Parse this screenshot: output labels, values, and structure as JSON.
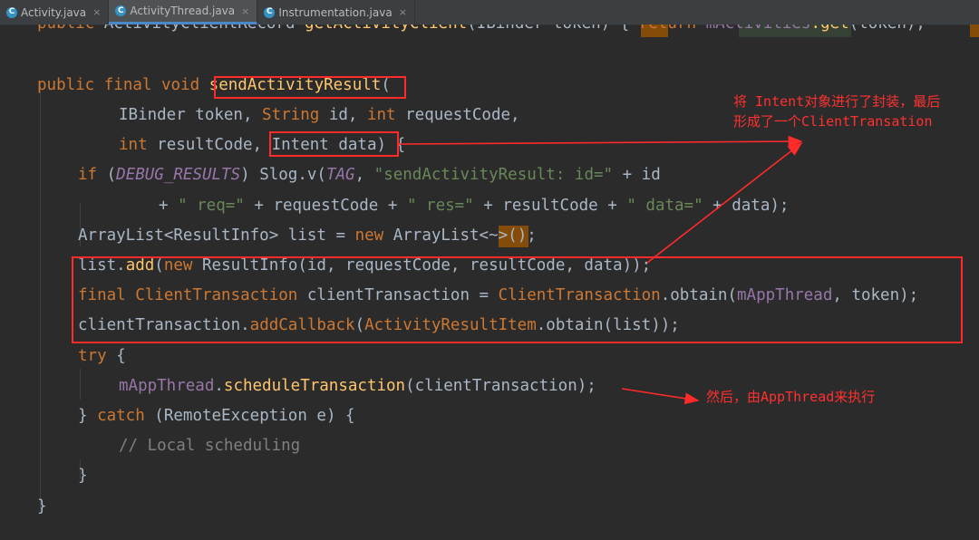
{
  "tabs": [
    {
      "icon": "C",
      "label": "Activity.java",
      "close": "×"
    },
    {
      "icon": "C",
      "label": "ActivityThread.java",
      "close": "×"
    },
    {
      "icon": "C",
      "label": "Instrumentation.java",
      "close": "×"
    }
  ],
  "code": {
    "l0": {
      "t1": "public ",
      "t2": "ActivityClientRecord ",
      "t3": "getActivityClient",
      "t4": "(IBinder token) ",
      "t5": "{",
      "t6": " return ",
      "t7": "mActivities",
      "t8": ".get",
      "t9": "(token);"
    },
    "l1": {
      "t1": "public ",
      "t2": "final ",
      "t3": "void ",
      "t4": "sendActivityResult",
      "t5": "("
    },
    "l2": {
      "t1": "IBinder token, ",
      "t2": "String ",
      "t3": "id, ",
      "t4": "int ",
      "t5": "requestCode,"
    },
    "l3": {
      "t1": "int ",
      "t2": "resultCode, ",
      "t3": "Intent ",
      "t4": "data",
      "t5": ")",
      "t6": " {"
    },
    "l4": {
      "t1": "if ",
      "t2": "(",
      "t3": "DEBUG_RESULTS",
      "t4": ") ",
      "t5": "Slog",
      "t6": ".v(",
      "t7": "TAG",
      "t8": ", ",
      "t9": "\"sendActivityResult: id=\"",
      "t10": " + id"
    },
    "l5": {
      "t1": "+ ",
      "t2": "\" req=\"",
      "t3": " + requestCode + ",
      "t4": "\" res=\"",
      "t5": " + resultCode + ",
      "t6": "\" data=\"",
      "t7": " + data);"
    },
    "l6": {
      "t1": "ArrayList",
      "t2": "<ResultInfo> ",
      "t3": "list = ",
      "t4": "new ",
      "t5": "ArrayList",
      "t6": "<~>",
      "t7": "();"
    },
    "l7": {
      "t1": "list.",
      "t2": "add",
      "t3": "(",
      "t4": "new ",
      "t5": "ResultInfo",
      "t6": "(id, requestCode, resultCode, data));"
    },
    "l8": {
      "t1": "final ",
      "t2": "ClientTransaction ",
      "t3": "clientTransaction = ",
      "t4": "ClientTransaction",
      "t5": ".obtain(",
      "t6": "mAppThread",
      "t7": ", token);"
    },
    "l9": {
      "t1": "clientTransaction.",
      "t2": "addCallback",
      "t3": "(",
      "t4": "ActivityResultItem",
      "t5": ".obtain(list));"
    },
    "l10": {
      "t1": "try ",
      "t2": "{"
    },
    "l11": {
      "t1": "mAppThread",
      "t2": ".",
      "t3": "scheduleTransaction",
      "t4": "(clientTransaction);"
    },
    "l12": {
      "t1": "} ",
      "t2": "catch ",
      "t3": "(",
      "t4": "RemoteException ",
      "t5": "e) {"
    },
    "l13": {
      "t1": "// Local scheduling"
    },
    "l14": {
      "t1": "}"
    },
    "l15": {
      "t1": "}"
    }
  },
  "annotations": {
    "note1_line1": "将 Intent对象进行了封装，最后",
    "note1_line2": "形成了一个ClientTransation",
    "note2": "然后，由AppThread来执行"
  },
  "colors": {
    "background": "#2b2b2b",
    "keyword": "#cc7832",
    "method": "#ffc66d",
    "string": "#6a8759",
    "annotation_red": "#ff2a2a"
  }
}
